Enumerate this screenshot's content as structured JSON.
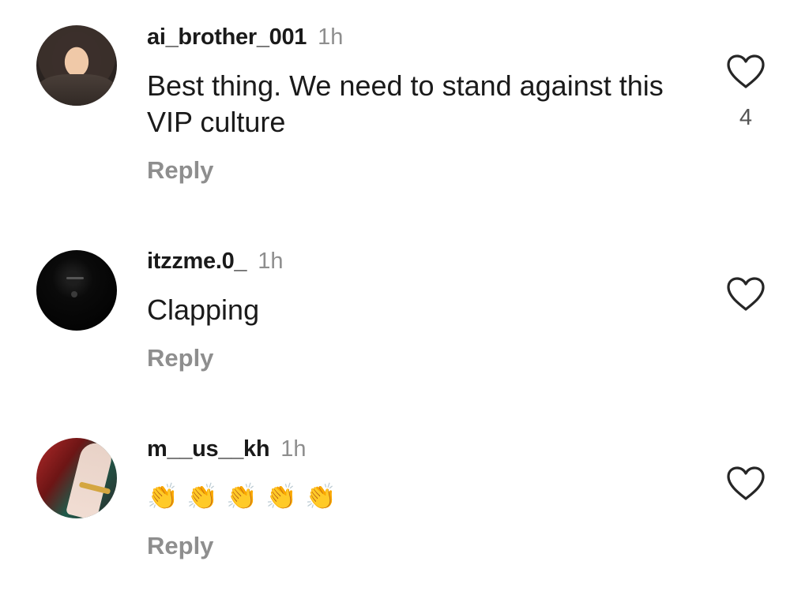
{
  "comments": [
    {
      "username": "ai_brother_001",
      "time": "1h",
      "text": "Best thing.  We need to stand against this VIP culture",
      "likes": "4",
      "reply_label": "Reply"
    },
    {
      "username": "itzzme.0_",
      "time": "1h",
      "text": "Clapping",
      "reply_label": "Reply"
    },
    {
      "username": "m__us__kh",
      "time": "1h",
      "emojis": [
        "👏",
        "👏",
        "👏",
        "👏",
        "👏"
      ],
      "reply_label": "Reply"
    }
  ],
  "icons": {
    "like": "heart-outline-icon"
  },
  "colors": {
    "primary_text": "#1a1a1a",
    "secondary_text": "#8e8e8e",
    "background": "#ffffff"
  }
}
